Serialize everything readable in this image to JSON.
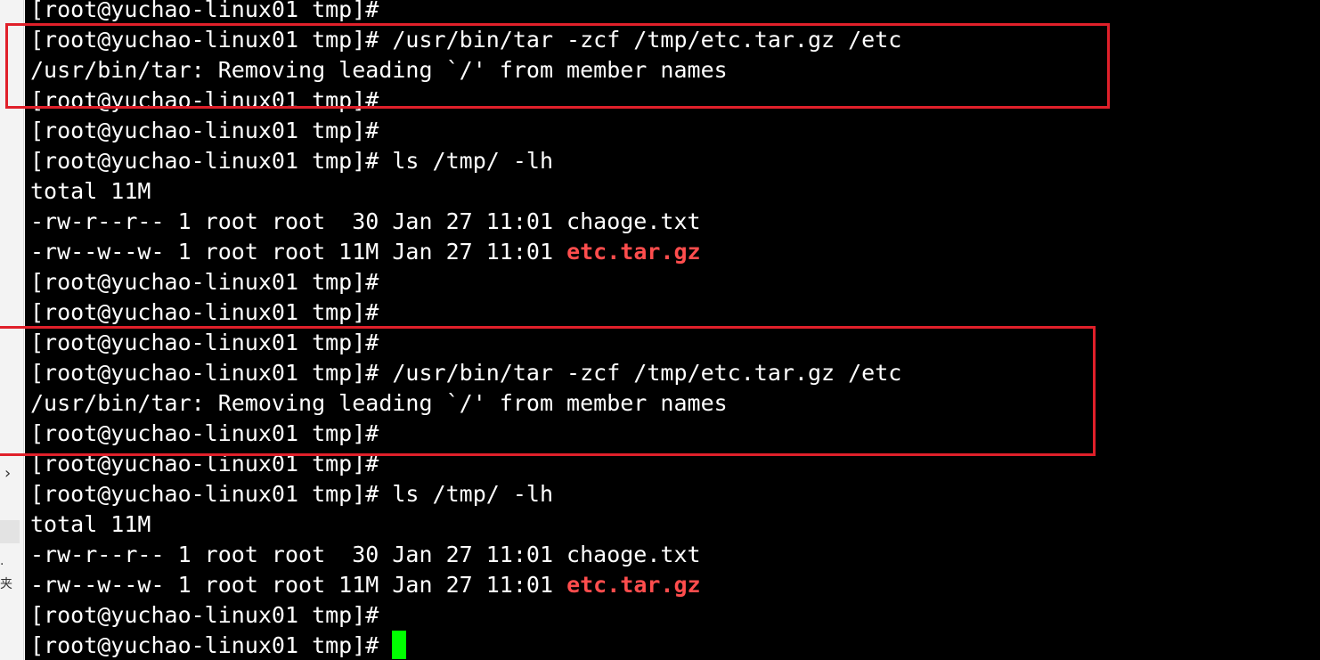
{
  "sidebar": {
    "chevron": "›",
    "text_a": ".",
    "text_b": "夹"
  },
  "terminal": {
    "lines": [
      {
        "text": "[root@yuchao-linux01 tmp]#"
      },
      {
        "text": "[root@yuchao-linux01 tmp]# /usr/bin/tar -zcf /tmp/etc.tar.gz /etc"
      },
      {
        "text": "/usr/bin/tar: Removing leading `/' from member names"
      },
      {
        "text": "[root@yuchao-linux01 tmp]#"
      },
      {
        "text": "[root@yuchao-linux01 tmp]#"
      },
      {
        "text": "[root@yuchao-linux01 tmp]# ls /tmp/ -lh"
      },
      {
        "text": "total 11M"
      },
      {
        "text": "-rw-r--r-- 1 root root  30 Jan 27 11:01 chaoge.txt"
      },
      {
        "text": "-rw--w--w- 1 root root 11M Jan 27 11:01 ",
        "file": "etc.tar.gz"
      },
      {
        "text": "[root@yuchao-linux01 tmp]#"
      },
      {
        "text": "[root@yuchao-linux01 tmp]#"
      },
      {
        "text": "[root@yuchao-linux01 tmp]#"
      },
      {
        "text": "[root@yuchao-linux01 tmp]# /usr/bin/tar -zcf /tmp/etc.tar.gz /etc"
      },
      {
        "text": "/usr/bin/tar: Removing leading `/' from member names"
      },
      {
        "text": "[root@yuchao-linux01 tmp]#"
      },
      {
        "text": "[root@yuchao-linux01 tmp]#"
      },
      {
        "text": "[root@yuchao-linux01 tmp]# ls /tmp/ -lh"
      },
      {
        "text": "total 11M"
      },
      {
        "text": "-rw-r--r-- 1 root root  30 Jan 27 11:01 chaoge.txt"
      },
      {
        "text": "-rw--w--w- 1 root root 11M Jan 27 11:01 ",
        "file": "etc.tar.gz"
      },
      {
        "text": "[root@yuchao-linux01 tmp]#"
      },
      {
        "text": "[root@yuchao-linux01 tmp]# ",
        "cursor": true
      }
    ]
  },
  "colors": {
    "background": "#000000",
    "text": "#ffffff",
    "archive_file": "#ff4d4d",
    "cursor": "#00ff00",
    "annotation_box": "#e0202a"
  }
}
